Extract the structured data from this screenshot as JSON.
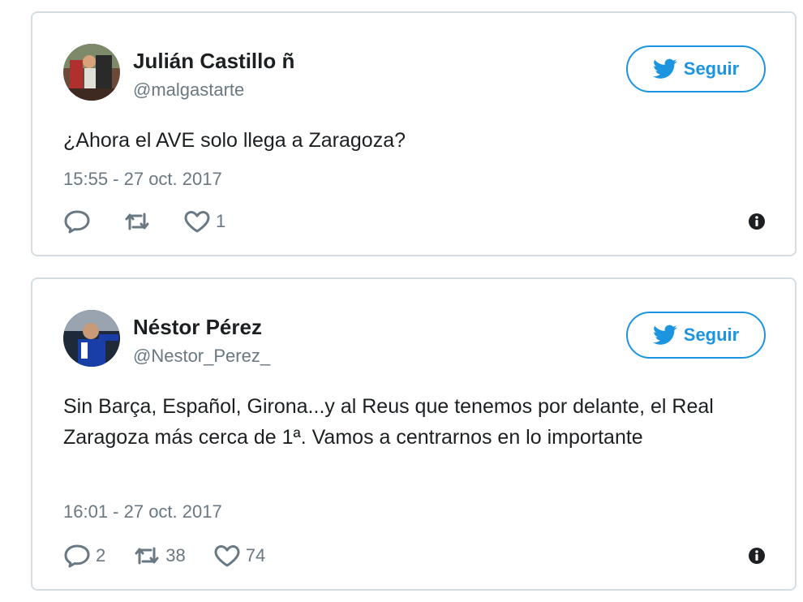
{
  "colors": {
    "twitter_blue": "#1b95e0",
    "text": "#1c2022",
    "muted": "#697882",
    "border": "#d5dde3"
  },
  "tweets": [
    {
      "name": "Julián Castillo ñ",
      "handle": "@malgastarte",
      "follow_label": "Seguir",
      "text": "¿Ahora el AVE solo llega a Zaragoza?",
      "timestamp": "15:55 - 27 oct. 2017",
      "replies": "",
      "retweets": "",
      "likes": "1"
    },
    {
      "name": "Néstor Pérez",
      "handle": "@Nestor_Perez_",
      "follow_label": "Seguir",
      "text": "Sin Barça, Español, Girona...y al Reus que tenemos por delante, el Real Zaragoza más cerca de 1ª. Vamos a centrarnos en lo importante",
      "timestamp": "16:01 - 27 oct. 2017",
      "replies": "2",
      "retweets": "38",
      "likes": "74"
    }
  ],
  "icons": {
    "follow": "twitter-bird-icon",
    "reply": "reply-icon",
    "retweet": "retweet-icon",
    "like": "heart-icon",
    "info": "info-icon"
  }
}
